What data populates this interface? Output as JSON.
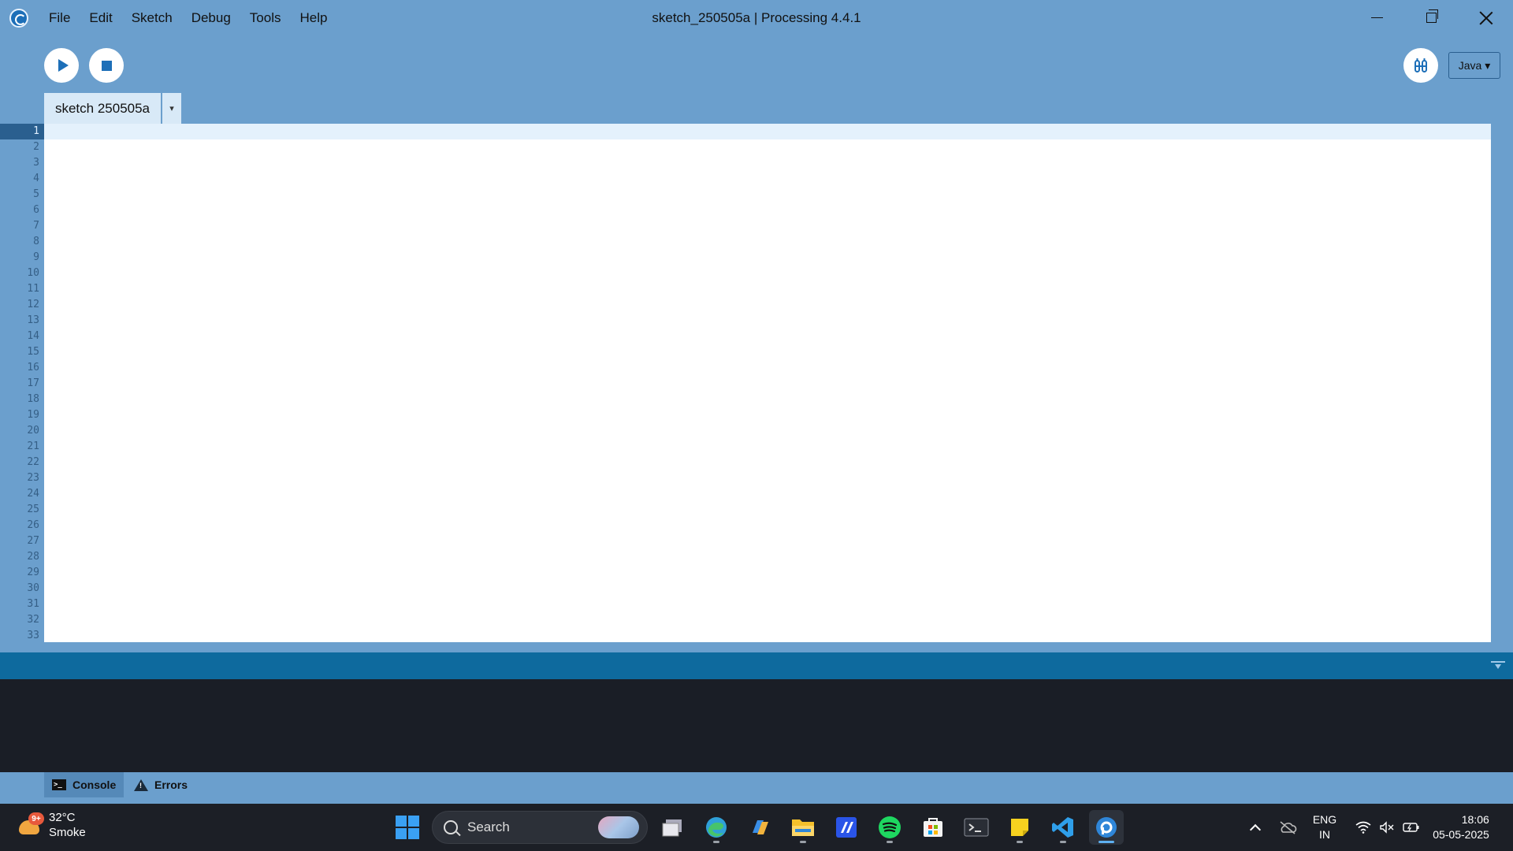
{
  "window": {
    "title": "sketch_250505a | Processing 4.4.1"
  },
  "menu": [
    "File",
    "Edit",
    "Sketch",
    "Debug",
    "Tools",
    "Help"
  ],
  "toolbar": {
    "mode_label": "Java",
    "mode_arrow": "▾"
  },
  "tabs": [
    {
      "label": "sketch 250505a"
    }
  ],
  "tab_menu_arrow": "▾",
  "editor": {
    "line_numbers": [
      "1",
      "2",
      "3",
      "4",
      "5",
      "6",
      "7",
      "8",
      "9",
      "10",
      "11",
      "12",
      "13",
      "14",
      "15",
      "16",
      "17",
      "18",
      "19",
      "20",
      "21",
      "22",
      "23",
      "24",
      "25",
      "26",
      "27",
      "28",
      "29",
      "30",
      "31",
      "32",
      "33"
    ],
    "current_line": 1
  },
  "console_tabs": {
    "console": "Console",
    "errors": "Errors"
  },
  "taskbar": {
    "weather": {
      "temp": "32°C",
      "condition": "Smoke",
      "badge": "9+"
    },
    "search_label": "Search",
    "language": {
      "line1": "ENG",
      "line2": "IN"
    },
    "clock": {
      "time": "18:06",
      "date": "05-05-2025"
    }
  },
  "colors": {
    "chrome": "#6b9fcd",
    "accent": "#1d6fb8",
    "status_bar": "#0e6a9e",
    "console_bg": "#1a1e26"
  },
  "icons": {
    "apps": [
      "task-view-icon",
      "edge-icon",
      "copilot-icon",
      "file-explorer-icon",
      "ide-icon",
      "spotify-icon",
      "store-icon",
      "terminal-icon",
      "sticky-notes-icon",
      "vscode-icon",
      "processing-icon"
    ]
  }
}
